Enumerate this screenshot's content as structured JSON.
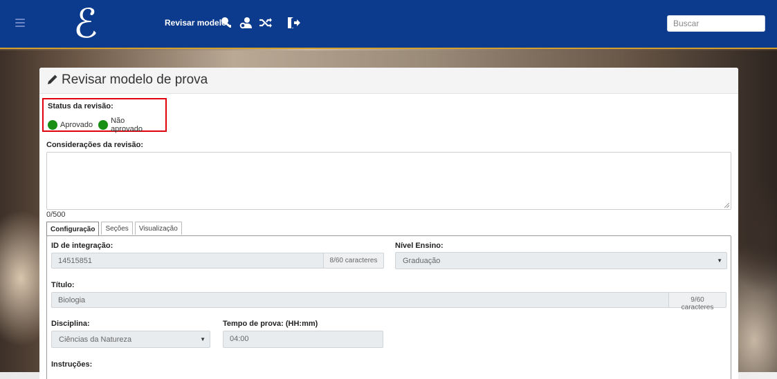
{
  "navbar": {
    "logo_text": "ℰ",
    "title_link": "Revisar modelo",
    "icons": [
      "key-user-icon",
      "user-settings-icon",
      "shuffle-icon",
      "logout-icon"
    ],
    "search_placeholder": "Buscar",
    "bg_color": "#0c3b8e",
    "accent_color": "#d6a030"
  },
  "panel": {
    "title": "Revisar modelo de prova"
  },
  "status": {
    "label": "Status da revisão:",
    "options": [
      "Aprovado",
      "Não aprovado"
    ],
    "dot_color": "#1a8f16",
    "highlight_color": "#e0000b"
  },
  "considerations": {
    "label": "Considerações da revisão:",
    "value": "",
    "counter": "0/500"
  },
  "tabs": [
    "Configuração",
    "Seções",
    "Visualização"
  ],
  "active_tab": "Configuração",
  "form": {
    "integration_id": {
      "label": "ID de integração:",
      "value": "14515851",
      "addon": "8/60 caracteres"
    },
    "education_level": {
      "label": "Nível Ensino:",
      "value": "Graduação"
    },
    "title": {
      "label": "Título:",
      "value": "Biologia",
      "addon": "9/60 caracteres"
    },
    "discipline": {
      "label": "Disciplina:",
      "value": "Ciências da Natureza"
    },
    "duration": {
      "label": "Tempo de prova: (HH:mm)",
      "value": "04:00"
    },
    "instructions": {
      "label": "Instruções:"
    }
  }
}
